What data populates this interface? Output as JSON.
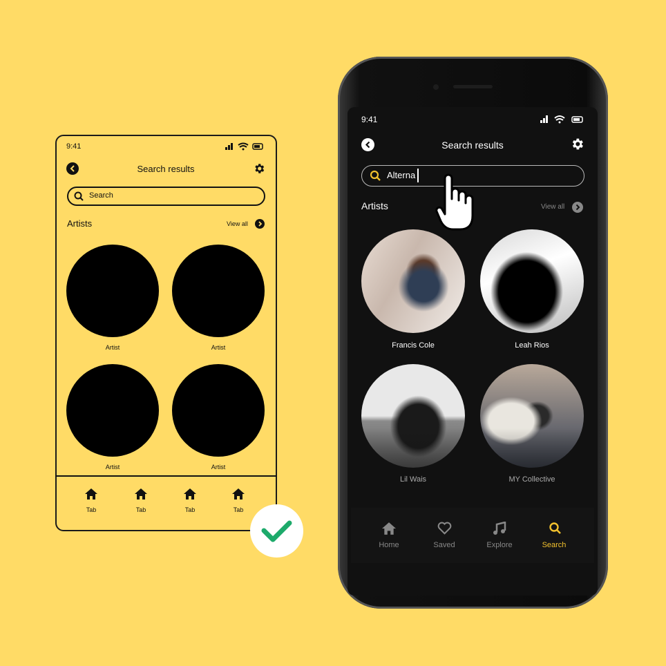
{
  "wireframe": {
    "status_time": "9:41",
    "title": "Search results",
    "search_placeholder": "Search",
    "section_title": "Artists",
    "view_all": "View all",
    "artists": [
      "Artist",
      "Artist",
      "Artist",
      "Artist"
    ],
    "tabs": [
      "Tab",
      "Tab",
      "Tab",
      "Tab"
    ]
  },
  "phone": {
    "status_time": "9:41",
    "title": "Search results",
    "search_value": "Alterna",
    "section_title": "Artists",
    "view_all": "View all",
    "artists": [
      "Francis Cole",
      "Leah Rios",
      "Lil Wais",
      "MY Collective"
    ],
    "tabs": [
      {
        "label": "Home",
        "icon": "home-icon"
      },
      {
        "label": "Saved",
        "icon": "heart-icon"
      },
      {
        "label": "Explore",
        "icon": "music-icon"
      },
      {
        "label": "Search",
        "icon": "search-icon",
        "active": true
      }
    ],
    "accent": "#F2C12E"
  },
  "colors": {
    "background": "#FFDB66",
    "check": "#1DAA6B"
  }
}
